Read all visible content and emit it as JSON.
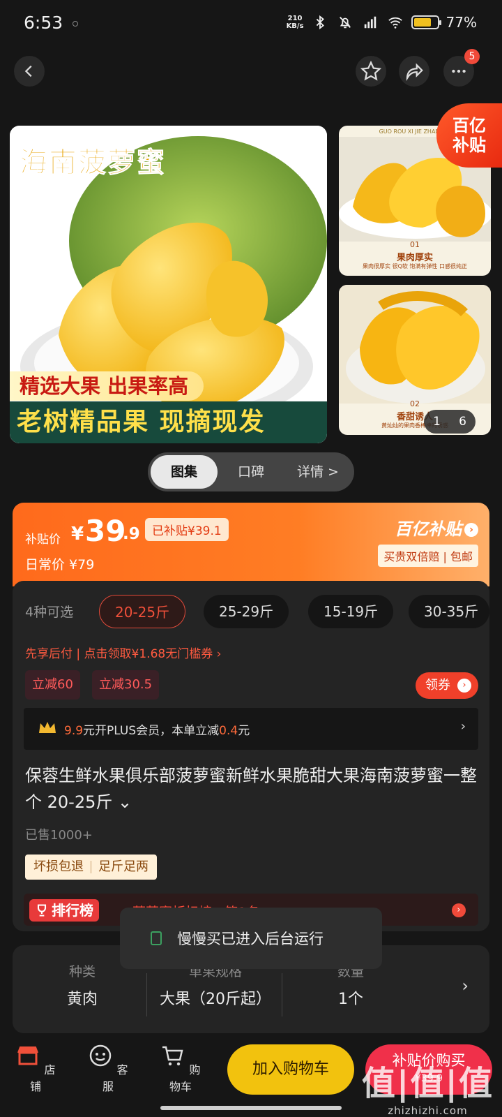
{
  "status_bar": {
    "time": "6:53",
    "net_speed_top": "210",
    "net_speed_unit": "KB/s",
    "network": "HD",
    "battery": "77%"
  },
  "top_nav": {
    "more_badge": "5"
  },
  "gallery": {
    "main_title": "海南菠萝蜜",
    "banner_line1": "精选大果 出果率高",
    "banner_line2": "老树精品果 现摘现发",
    "yi_tag_top": "百亿",
    "yi_tag_bottom": "补贴",
    "side1_header": "GUO ROU XI JIE ZHAN SHI",
    "side1_num": "01",
    "side1_caption": "果肉厚实",
    "side1_sub": "果肉很厚实 很Q软 饱满有弹性 口感很纯正",
    "side2_num": "02",
    "side2_caption": "香甜诱人",
    "side2_sub": "黄灿灿的果肉香棒棒的诱惑",
    "pager_current": "1",
    "pager_total": "6"
  },
  "tabs": [
    {
      "label": "图集",
      "active": true
    },
    {
      "label": "口碑",
      "active": false
    },
    {
      "label": "详情 >",
      "active": false
    }
  ],
  "price": {
    "label": "补贴价",
    "symbol": "¥",
    "integer": "39",
    "decimal": ".9",
    "subsidy": "已补贴¥39.1",
    "regular": "日常价 ¥79",
    "program": "百亿补贴",
    "benefits": "买贵双倍赔 | 包邮"
  },
  "options": {
    "count": "4种可选",
    "chips": [
      "20-25斤",
      "25-29斤",
      "15-19斤",
      "30-35斤"
    ],
    "credit": "先享后付 | 点击领取¥1.68无门槛券 ›",
    "reduce1": "立减60",
    "reduce2": "立减30.5",
    "coupon": "领券",
    "plus_price": "9.9",
    "plus_text1": "元开PLUS会员，本单立减",
    "plus_amount": "0.4",
    "plus_text2": "元"
  },
  "product": {
    "title": "保蓉生鲜水果俱乐部菠萝蜜新鲜水果脆甜大果海南菠萝蜜一整个 20-25斤 ⌄",
    "sold": "已售1000+",
    "guarantee1": "坏损包退",
    "guarantee2": "足斤足两",
    "rank_tag": "排行榜",
    "rank_text": "菠萝蜜折扣榜 · 第1名"
  },
  "toast": {
    "text": "慢慢买已进入后台运行"
  },
  "specs": [
    {
      "label": "种类",
      "value": "黄肉"
    },
    {
      "label": "单果规格",
      "value": "大果（20斤起）"
    },
    {
      "label": "数量",
      "value": "1个"
    }
  ],
  "bottom_bar": {
    "store": "店铺",
    "service": "客服",
    "cart": "购物车",
    "add_cart": "加入购物车",
    "buy": "补贴价购买",
    "buy_price": "¥39.9"
  },
  "watermark": {
    "big": "值|值|值",
    "small": "zhizhizhi.com"
  },
  "colors": {
    "accent_orange": "#ff6a1c",
    "accent_red": "#f0304a",
    "accent_yellow": "#f2c20e"
  }
}
